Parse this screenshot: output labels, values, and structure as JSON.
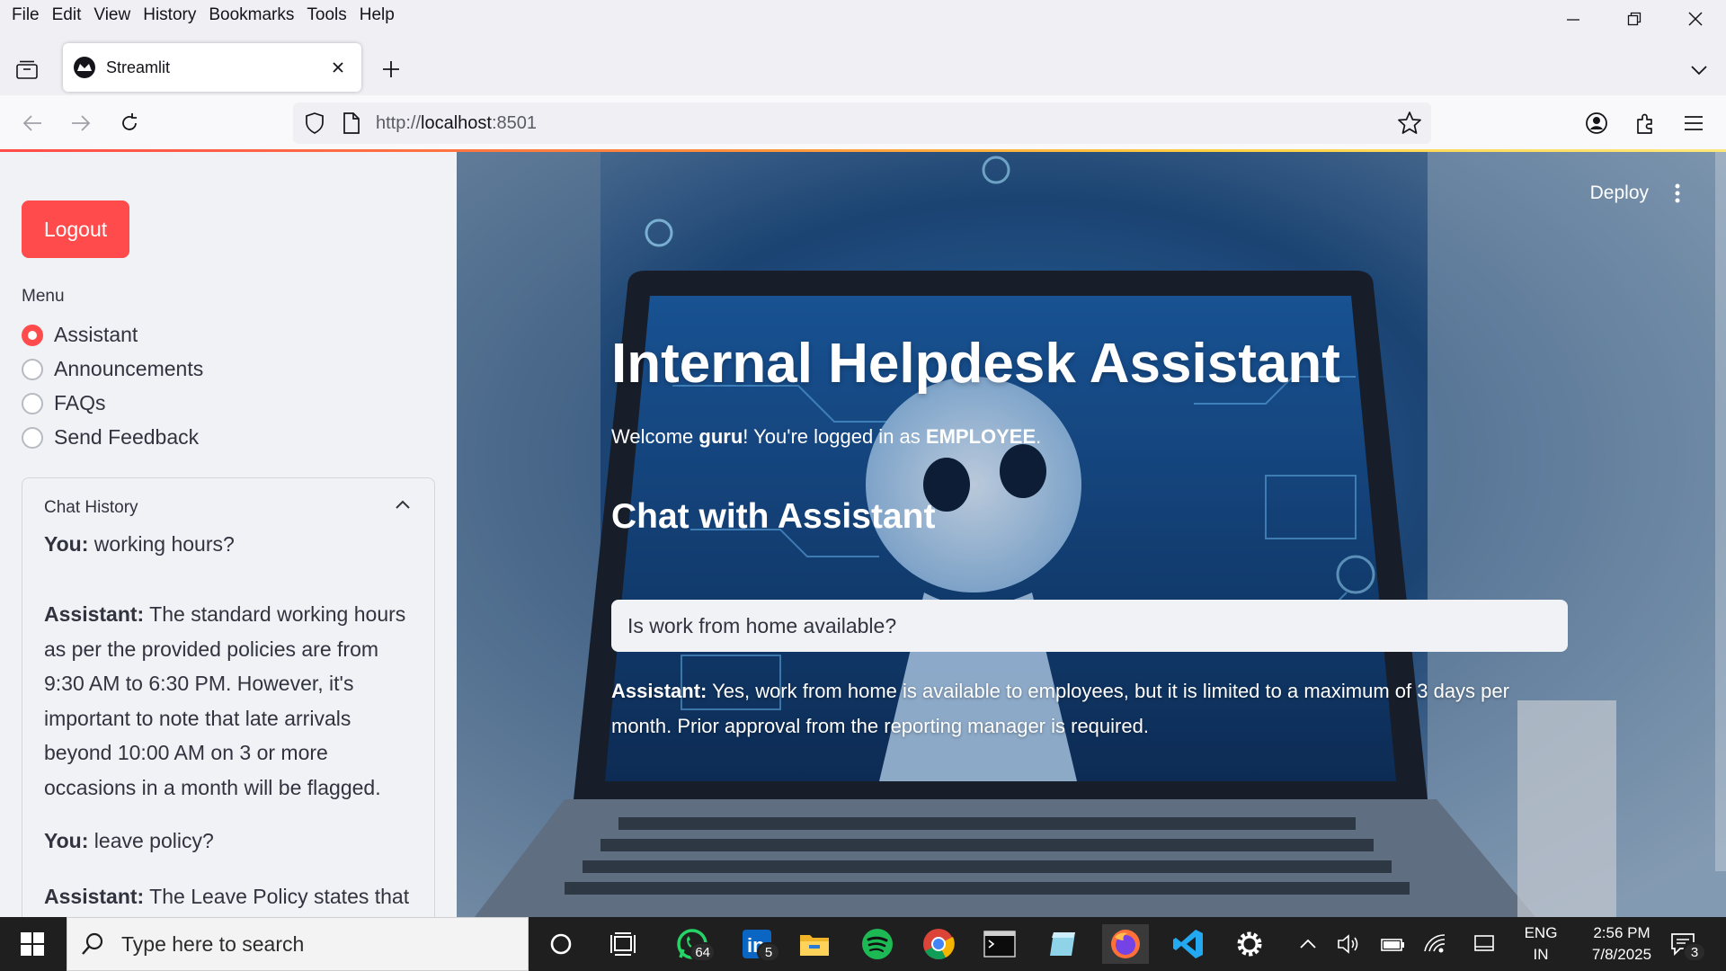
{
  "browser": {
    "menu": [
      "File",
      "Edit",
      "View",
      "History",
      "Bookmarks",
      "Tools",
      "Help"
    ],
    "tab_title": "Streamlit",
    "url_prefix": "http://",
    "url_host": "localhost",
    "url_port": ":8501"
  },
  "sidebar": {
    "logout_label": "Logout",
    "menu_label": "Menu",
    "menu_options": [
      "Assistant",
      "Announcements",
      "FAQs",
      "Send Feedback"
    ],
    "selected_option": "Assistant",
    "chat_history": {
      "title": "Chat History",
      "messages": [
        {
          "speaker": "You:",
          "text": " working hours?"
        },
        {
          "speaker": "Assistant:",
          "text": " The standard working hours as per the provided policies are from 9:30 AM to 6:30 PM. However, it's important to note that late arrivals beyond 10:00 AM on 3 or more occasions in a month will be flagged."
        },
        {
          "speaker": "You:",
          "text": " leave policy?"
        },
        {
          "speaker": "Assistant:",
          "text": " The Leave Policy states that"
        }
      ]
    }
  },
  "main": {
    "deploy_label": "Deploy",
    "title": "Internal Helpdesk Assistant",
    "welcome_prefix": "Welcome ",
    "welcome_user": "guru",
    "welcome_middle": "! You're logged in as ",
    "welcome_role": "EMPLOYEE",
    "welcome_suffix": ".",
    "chat_heading": "Chat with Assistant",
    "chat_input_value": "Is work from home available?",
    "answer_speaker": "Assistant:",
    "answer_text": " Yes, work from home is available to employees, but it is limited to a maximum of 3 days per month. Prior approval from the reporting manager is required."
  },
  "taskbar": {
    "search_placeholder": "Type here to search",
    "whatsapp_badge": "64",
    "linkedin_badge": "5",
    "lang_line1": "ENG",
    "lang_line2": "IN",
    "time": "2:56 PM",
    "date": "7/8/2025",
    "notification_count": "3"
  },
  "colors": {
    "accent": "#ff4b4b",
    "sidebar_bg": "#f0f2f6",
    "taskbar_bg": "#1f1f1f"
  }
}
